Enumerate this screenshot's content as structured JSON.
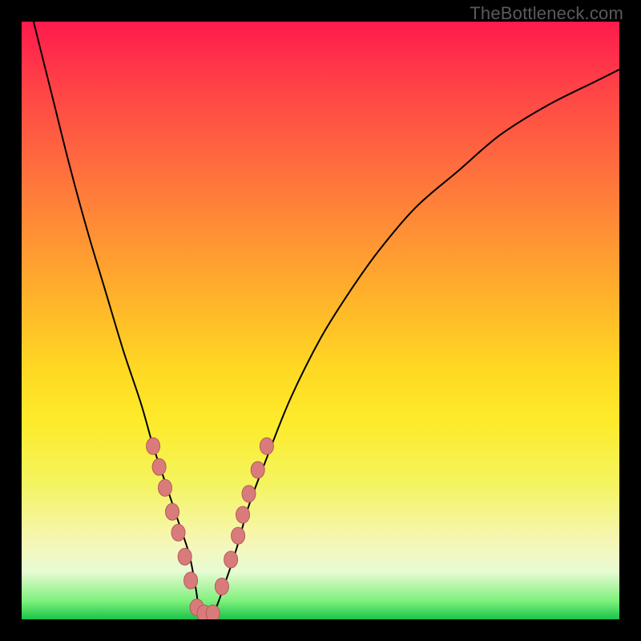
{
  "watermark": "TheBottleneck.com",
  "colors": {
    "frame": "#000000",
    "curve_stroke": "#000000",
    "marker_fill": "#d97b7b",
    "marker_stroke": "#b45a5a",
    "gradient_stops": [
      "#ff1a4d",
      "#ff693f",
      "#ffb52a",
      "#fdeb2a",
      "#f6f6b6",
      "#1ac24a"
    ]
  },
  "chart_data": {
    "type": "line",
    "title": "",
    "xlabel": "",
    "ylabel": "",
    "xlim": [
      0,
      100
    ],
    "ylim": [
      0,
      100
    ],
    "grid": false,
    "legend": false,
    "series": [
      {
        "name": "bottleneck-curve",
        "x": [
          2,
          5,
          8,
          11,
          14,
          17,
          20,
          22,
          24,
          26,
          28,
          29,
          30,
          32,
          34,
          36,
          38,
          41,
          45,
          50,
          55,
          60,
          66,
          73,
          80,
          88,
          96,
          100
        ],
        "y": [
          100,
          88,
          76,
          65,
          55,
          45,
          36,
          29,
          23,
          17,
          11,
          6,
          1,
          1,
          6,
          12,
          19,
          27,
          37,
          47,
          55,
          62,
          69,
          75,
          81,
          86,
          90,
          92
        ]
      }
    ],
    "markers": {
      "name": "highlighted-points",
      "x": [
        22.0,
        23.0,
        24.0,
        25.2,
        26.2,
        27.3,
        28.3,
        29.3,
        30.5,
        32.0,
        33.5,
        35.0,
        36.2,
        37.0,
        38.0,
        39.5,
        41.0
      ],
      "y": [
        29.0,
        25.5,
        22.0,
        18.0,
        14.5,
        10.5,
        6.5,
        2.0,
        1.0,
        1.0,
        5.5,
        10.0,
        14.0,
        17.5,
        21.0,
        25.0,
        29.0
      ]
    }
  }
}
